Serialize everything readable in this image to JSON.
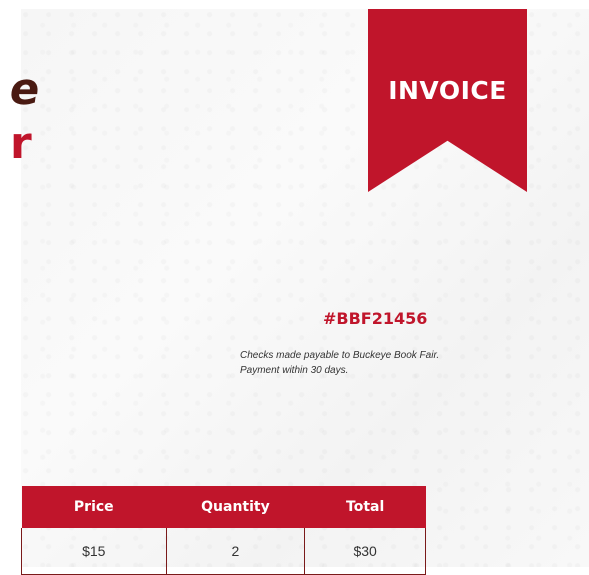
{
  "brand": {
    "line1": "e",
    "line2": "r"
  },
  "ribbon": {
    "label": "INVOICE"
  },
  "invoice": {
    "number": "#BBF21456",
    "payment_note": "Checks made payable to Buckeye Book Fair. Payment within 30 days."
  },
  "table": {
    "headers": [
      "Price",
      "Quantity",
      "Total"
    ],
    "rows": [
      [
        "$15",
        "2",
        "$30"
      ]
    ]
  },
  "colors": {
    "accent": "#c0152b",
    "brand_dark": "#4a1a12"
  }
}
